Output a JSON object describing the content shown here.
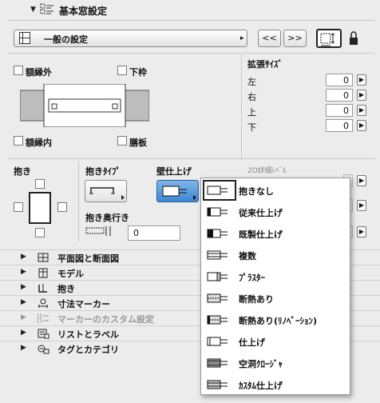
{
  "header": {
    "title": "基本窓設定"
  },
  "settings_dropdown": {
    "label": "一般の設定"
  },
  "nav": {
    "prev_label": "<<",
    "next_label": ">>"
  },
  "checkboxes": {
    "frame_outer": "額縁外",
    "bottom_frame": "下枠",
    "frame_inner": "額縁内",
    "sill": "膳板"
  },
  "extension": {
    "title": "拡張ｻｲｽﾞ",
    "rows": [
      {
        "side": "左",
        "value": "0"
      },
      {
        "side": "右",
        "value": "0"
      },
      {
        "side": "上",
        "value": "0"
      },
      {
        "side": "下",
        "value": "0"
      }
    ]
  },
  "reveal": {
    "title": "抱き",
    "type_label": "抱きﾀｲﾌﾟ",
    "wall_finish_label": "壁仕上げ",
    "depth_label": "抱き奥行き",
    "depth_value": "0",
    "detail_label": "2D詳細ﾚﾍﾞﾙ"
  },
  "sections": [
    {
      "label": "平面図と断面図",
      "icon": "floor-plan-icon",
      "disabled": false
    },
    {
      "label": "モデル",
      "icon": "model-icon",
      "disabled": false
    },
    {
      "label": "抱き",
      "icon": "reveal-icon",
      "disabled": false
    },
    {
      "label": "寸法マーカー",
      "icon": "dimension-marker-icon",
      "disabled": false
    },
    {
      "label": "マーカーのカスタム設定",
      "icon": "custom-marker-icon",
      "disabled": true
    },
    {
      "label": "リストとラベル",
      "icon": "list-label-icon",
      "disabled": false
    },
    {
      "label": "タグとカテゴリ",
      "icon": "tag-category-icon",
      "disabled": false
    }
  ],
  "wall_finish_menu": {
    "items": [
      {
        "label": "抱きなし",
        "icon": "no-reveal-icon"
      },
      {
        "label": "従来仕上げ",
        "icon": "traditional-finish-icon"
      },
      {
        "label": "既製仕上げ",
        "icon": "prefab-finish-icon"
      },
      {
        "label": "複数",
        "icon": "multiple-icon"
      },
      {
        "label": "ﾌﾟﾗｽﾀｰ",
        "icon": "plaster-icon"
      },
      {
        "label": "断熱あり",
        "icon": "insulated-icon"
      },
      {
        "label": "断熱あり(ﾘﾉﾍﾞｰｼｮﾝ)",
        "icon": "insulated-renovation-icon"
      },
      {
        "label": "仕上げ",
        "icon": "finish-icon"
      },
      {
        "label": "空洞ｸﾛｰｼﾞｬ",
        "icon": "cavity-closure-icon"
      },
      {
        "label": "ｶｽﾀﾑ仕上げ",
        "icon": "custom-finish-icon"
      }
    ]
  }
}
